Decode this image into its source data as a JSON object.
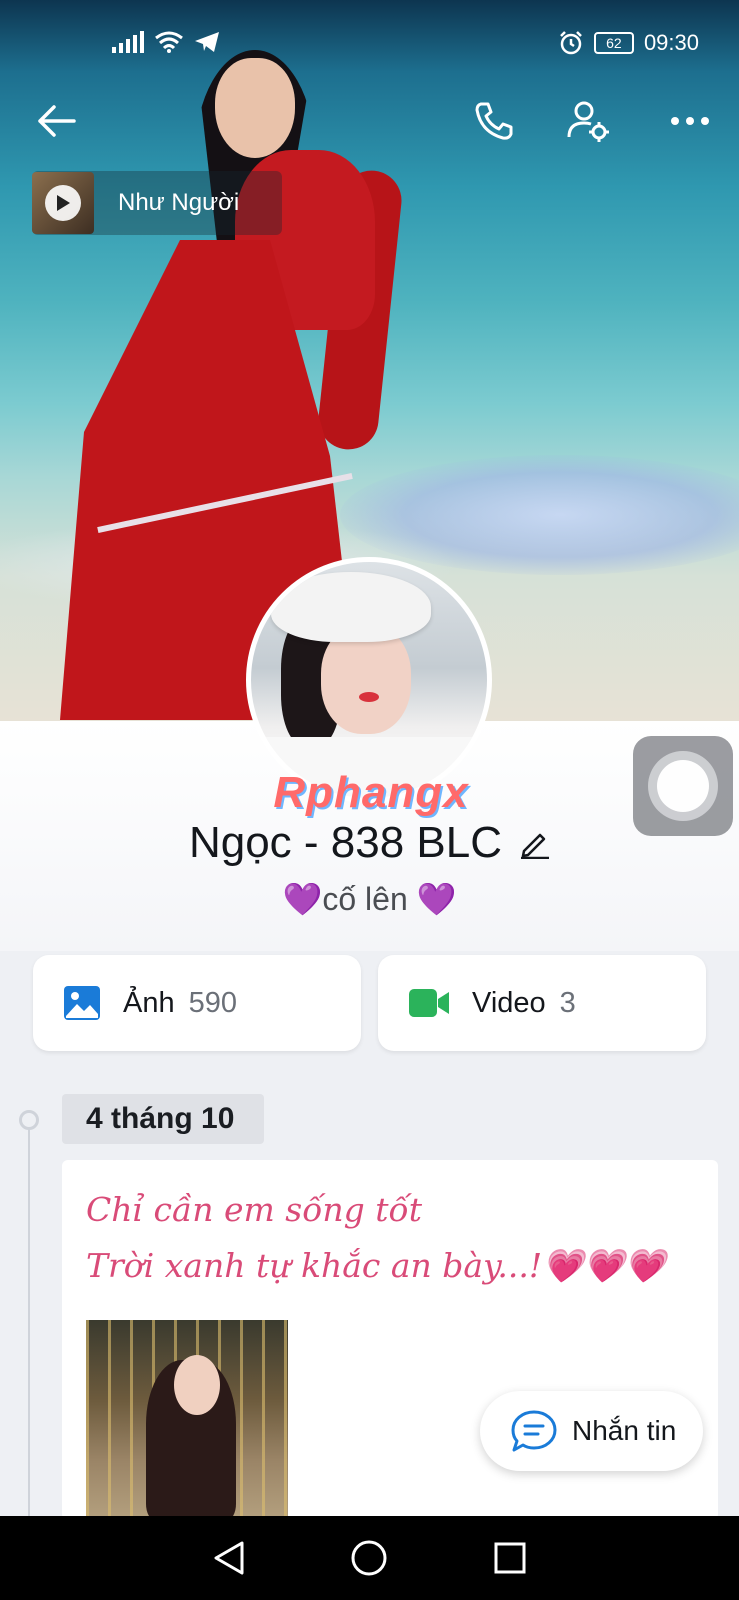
{
  "status_bar": {
    "time": "09:30",
    "battery_level": "62",
    "icons": [
      "signal-icon",
      "wifi-icon",
      "telegram-icon",
      "alarm-icon",
      "battery-icon"
    ]
  },
  "header": {
    "icons": [
      "back-arrow-icon",
      "phone-icon",
      "profile-settings-icon",
      "more-icon"
    ]
  },
  "music": {
    "title": "Như Người"
  },
  "watermark": "Rphangx",
  "profile": {
    "name": "Ngọc - 838 BLC",
    "status_text": "cố lên",
    "status_emoji_left": "💜",
    "status_emoji_right": " 💜"
  },
  "media": {
    "photos_label": "Ảnh",
    "photos_count": "590",
    "videos_label": "Video",
    "videos_count": "3"
  },
  "timeline": {
    "date": "4 tháng 10",
    "post": {
      "line1": "Chỉ cần em sống tốt",
      "line2": "Trời xanh tự khắc an bày...!💗💗💗"
    }
  },
  "message_button": {
    "label": "Nhắn tin"
  },
  "colors": {
    "accent_blue": "#1a7bd8",
    "video_green": "#2bb35b",
    "post_text_pink": "#d94b78"
  }
}
